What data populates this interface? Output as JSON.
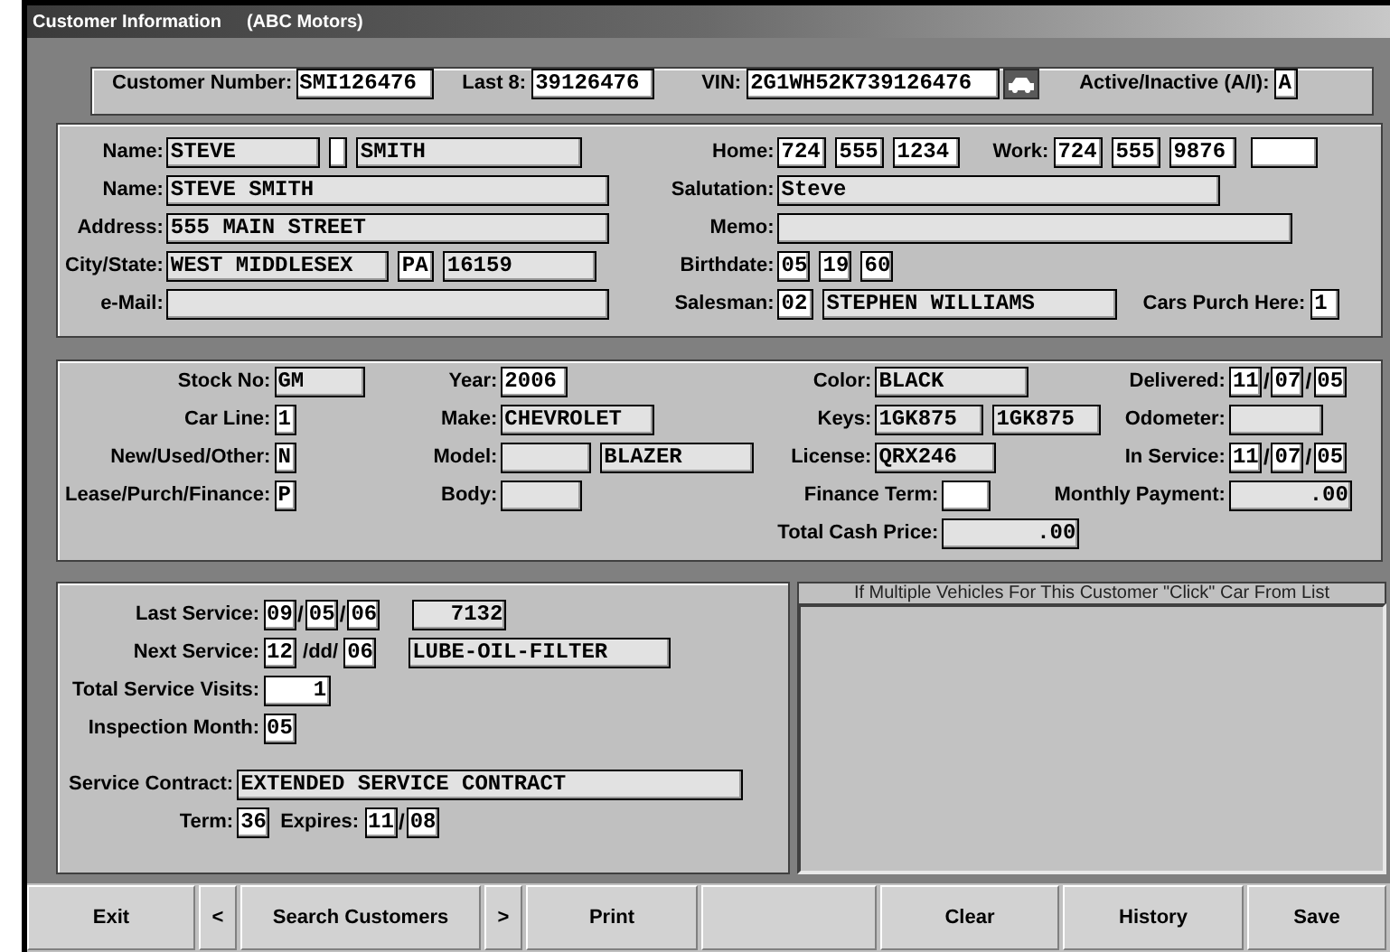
{
  "window": {
    "title": "Customer Information",
    "subtitle": "(ABC Motors)"
  },
  "panels": [
    {
      "columns": [
        {
          "rows": [
            {
              "label": "Customer Number:",
              "parts": [
                {
                  "kind": "field",
                  "value": "SMI126476"
                },
                {
                  "kind": "label",
                  "text": "Last 8:"
                },
                {
                  "kind": "field",
                  "value": "39126476"
                },
                {
                  "kind": "label",
                  "text": "VIN:"
                },
                {
                  "kind": "field",
                  "value": "2G1WH52K739126476"
                },
                {
                  "kind": "button"
                },
                {
                  "kind": "label",
                  "text": "Active/Inactive (A/I):"
                },
                {
                  "kind": "field",
                  "value": "A"
                }
              ]
            }
          ]
        }
      ]
    },
    {
      "columns": [
        {
          "rows": [
            {
              "label": "Name:",
              "parts": [
                {
                  "kind": "field",
                  "value": "STEVE"
                },
                {
                  "kind": "field"
                },
                {
                  "kind": "field",
                  "value": "SMITH"
                }
              ]
            },
            {
              "label": "Name:",
              "parts": [
                {
                  "kind": "field",
                  "value": "STEVE SMITH"
                }
              ]
            },
            {
              "label": "Address:",
              "parts": [
                {
                  "kind": "field",
                  "value": "555 MAIN STREET"
                }
              ]
            },
            {
              "label": "City/State:",
              "parts": [
                {
                  "kind": "field",
                  "value": "WEST MIDDLESEX"
                },
                {
                  "kind": "field",
                  "value": "PA"
                },
                {
                  "kind": "field",
                  "value": "16159"
                }
              ]
            },
            {
              "label": "e-Mail:",
              "parts": [
                {
                  "kind": "field"
                }
              ]
            }
          ]
        },
        {
          "rows": [
            {
              "label": "Home:",
              "parts": [
                {
                  "kind": "field",
                  "value": "724"
                },
                {
                  "kind": "field",
                  "value": "555"
                },
                {
                  "kind": "field",
                  "value": "1234"
                },
                {
                  "kind": "label",
                  "text": "Work:"
                },
                {
                  "kind": "field",
                  "value": "724"
                },
                {
                  "kind": "field",
                  "value": "555"
                },
                {
                  "kind": "field",
                  "value": "9876"
                },
                {
                  "kind": "field"
                }
              ]
            },
            {
              "label": "Salutation:",
              "parts": [
                {
                  "kind": "field",
                  "value": "Steve"
                }
              ]
            },
            {
              "label": "Memo:",
              "parts": [
                {
                  "kind": "field"
                }
              ]
            },
            {
              "label": "Birthdate:",
              "parts": [
                {
                  "kind": "field",
                  "value": "05"
                },
                {
                  "kind": "field",
                  "value": "19"
                },
                {
                  "kind": "field",
                  "value": "60"
                }
              ]
            },
            {
              "label": "Salesman:",
              "parts": [
                {
                  "kind": "field",
                  "value": "02"
                },
                {
                  "kind": "field",
                  "value": "STEPHEN WILLIAMS"
                },
                {
                  "kind": "label",
                  "text": "Cars Purch Here:"
                },
                {
                  "kind": "field",
                  "value": "1"
                }
              ]
            }
          ]
        }
      ]
    },
    {
      "columns": [
        {
          "rows": [
            {
              "label": "Stock No:",
              "parts": [
                {
                  "kind": "field",
                  "value": "GM"
                }
              ]
            },
            {
              "label": "Car Line:",
              "parts": [
                {
                  "kind": "field",
                  "value": "1"
                }
              ]
            },
            {
              "label": "New/Used/Other:",
              "parts": [
                {
                  "kind": "field",
                  "value": "N"
                }
              ]
            },
            {
              "label": "Lease/Purch/Finance:",
              "parts": [
                {
                  "kind": "field",
                  "value": "P"
                }
              ]
            }
          ]
        },
        {
          "rows": [
            {
              "label": "Year:",
              "parts": [
                {
                  "kind": "field",
                  "value": "2006"
                }
              ]
            },
            {
              "label": "Make:",
              "parts": [
                {
                  "kind": "field",
                  "value": "CHEVROLET"
                }
              ]
            },
            {
              "label": "Model:",
              "parts": [
                {
                  "kind": "field"
                },
                {
                  "kind": "field",
                  "value": "BLAZER"
                }
              ]
            },
            {
              "label": "Body:",
              "parts": [
                {
                  "kind": "field"
                }
              ]
            }
          ]
        },
        {
          "rows": [
            {
              "label": "Color:",
              "parts": [
                {
                  "kind": "field",
                  "value": "BLACK"
                }
              ]
            },
            {
              "label": "Keys:",
              "parts": [
                {
                  "kind": "field",
                  "value": "1GK875"
                },
                {
                  "kind": "field",
                  "value": "1GK875"
                }
              ]
            },
            {
              "label": "License:",
              "parts": [
                {
                  "kind": "field",
                  "value": "QRX246"
                }
              ]
            },
            {
              "label": "Finance Term:",
              "parts": [
                {
                  "kind": "field"
                }
              ]
            },
            {
              "label": "Total Cash Price:",
              "parts": [
                {
                  "kind": "field",
                  "value": ".00"
                }
              ]
            }
          ]
        },
        {
          "rows": [
            {
              "label": "Delivered:",
              "parts": [
                {
                  "kind": "field",
                  "value": "11"
                },
                {
                  "kind": "sep",
                  "text": "/"
                },
                {
                  "kind": "field",
                  "value": "07"
                },
                {
                  "kind": "sep",
                  "text": "/"
                },
                {
                  "kind": "field",
                  "value": "05"
                }
              ]
            },
            {
              "label": "Odometer:",
              "parts": [
                {
                  "kind": "field"
                }
              ]
            },
            {
              "label": "In Service:",
              "parts": [
                {
                  "kind": "field",
                  "value": "11"
                },
                {
                  "kind": "sep",
                  "text": "/"
                },
                {
                  "kind": "field",
                  "value": "07"
                },
                {
                  "kind": "sep",
                  "text": "/"
                },
                {
                  "kind": "field",
                  "value": "05"
                }
              ]
            },
            {
              "label": "Monthly Payment:",
              "parts": [
                {
                  "kind": "field",
                  "value": ".00"
                }
              ]
            }
          ]
        }
      ]
    },
    {
      "columns": [
        {
          "rows": [
            {
              "label": "Last Service:",
              "parts": [
                {
                  "kind": "field",
                  "value": "09"
                },
                {
                  "kind": "sep",
                  "text": "/"
                },
                {
                  "kind": "field",
                  "value": "05"
                },
                {
                  "kind": "sep",
                  "text": "/"
                },
                {
                  "kind": "field",
                  "value": "06"
                },
                {
                  "kind": "field",
                  "value": "7132"
                }
              ]
            },
            {
              "label": "Next Service:",
              "parts": [
                {
                  "kind": "field",
                  "value": "12"
                },
                {
                  "kind": "label",
                  "text": "/dd/"
                },
                {
                  "kind": "field",
                  "value": "06"
                },
                {
                  "kind": "field",
                  "value": "LUBE-OIL-FILTER"
                }
              ]
            },
            {
              "label": "Total Service Visits:",
              "parts": [
                {
                  "kind": "field",
                  "value": "1"
                }
              ]
            },
            {
              "label": "Inspection Month:",
              "parts": [
                {
                  "kind": "field",
                  "value": "05"
                }
              ]
            }
          ]
        },
        {
          "rows": [
            {
              "label": "Service Contract:",
              "parts": [
                {
                  "kind": "field",
                  "value": "EXTENDED SERVICE CONTRACT"
                }
              ]
            },
            {
              "label": "Term:",
              "parts": [
                {
                  "kind": "field",
                  "value": "36"
                },
                {
                  "kind": "label",
                  "text": "Expires:"
                },
                {
                  "kind": "field",
                  "value": "11"
                },
                {
                  "kind": "sep",
                  "text": "/"
                },
                {
                  "kind": "field",
                  "value": "08"
                }
              ]
            }
          ]
        }
      ]
    }
  ],
  "vehicle_list": {
    "caption": "If Multiple Vehicles For This Customer \"Click\" Car From List"
  },
  "buttons": [
    {
      "kind": "button",
      "label": "Exit"
    },
    {
      "kind": "button",
      "label": "<"
    },
    {
      "kind": "button",
      "label": "Search Customers"
    },
    {
      "kind": "button",
      "label": ">"
    },
    {
      "kind": "button",
      "label": "Print"
    },
    {
      "kind": "blank"
    },
    {
      "kind": "button",
      "label": "Clear"
    },
    {
      "kind": "button",
      "label": "History"
    },
    {
      "kind": "button",
      "label": "Save"
    }
  ]
}
